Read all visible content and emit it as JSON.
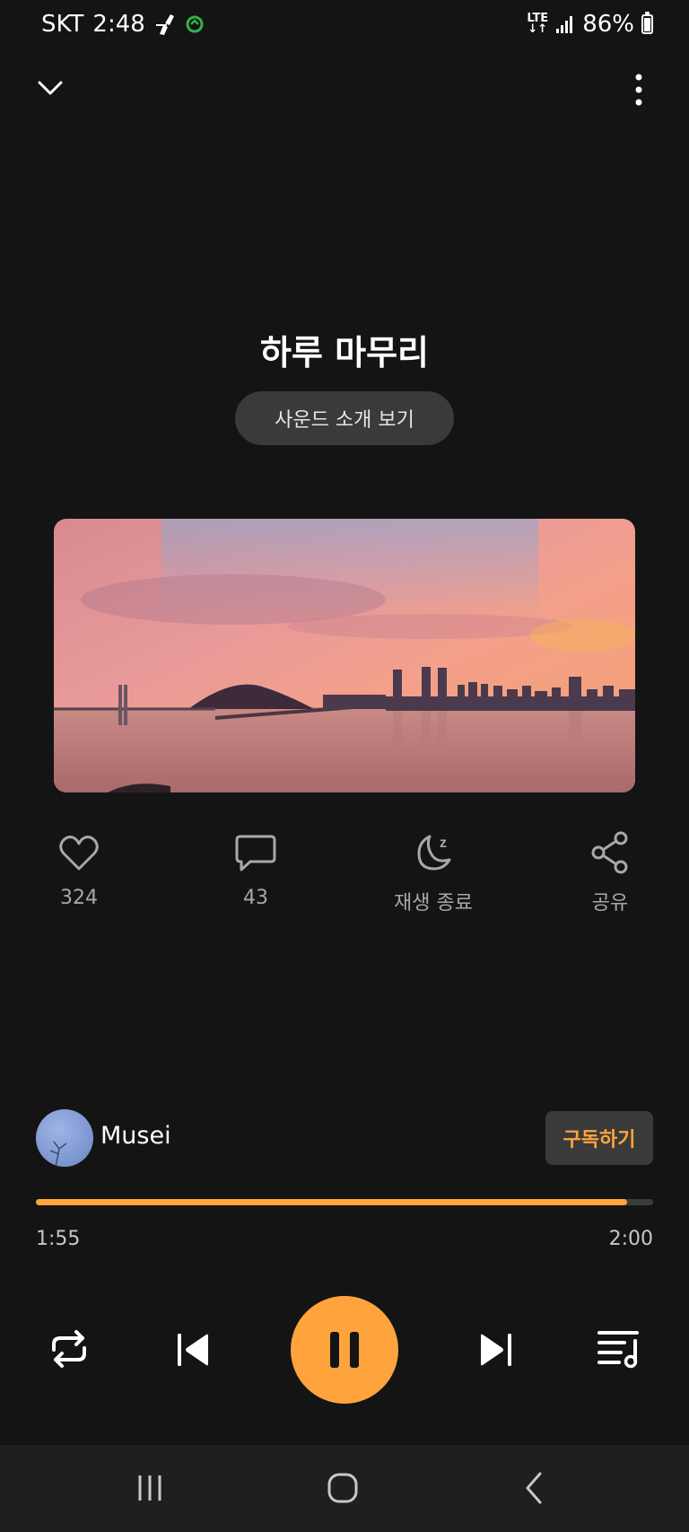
{
  "status_bar": {
    "carrier": "SKT",
    "time": "2:48",
    "network": "LTE",
    "battery": "86%"
  },
  "player": {
    "title": "하루 마무리",
    "intro_button": "사운드 소개 보기"
  },
  "actions": {
    "like_count": "324",
    "comment_count": "43",
    "sleep_timer_label": "재생 종료",
    "share_label": "공유"
  },
  "channel": {
    "name": "Musei",
    "subscribe_label": "구독하기"
  },
  "progress": {
    "elapsed": "1:55",
    "total": "2:00",
    "fraction": 0.958
  },
  "colors": {
    "accent": "#ffa43d",
    "background": "#141414"
  },
  "icons": {
    "collapse": "chevron-down-icon",
    "more": "more-vertical-icon",
    "like": "heart-icon",
    "comment": "comment-icon",
    "sleep": "moon-zz-icon",
    "share": "share-icon",
    "repeat": "repeat-icon",
    "previous": "skip-previous-icon",
    "pause": "pause-icon",
    "next": "skip-next-icon",
    "queue": "queue-music-icon"
  }
}
